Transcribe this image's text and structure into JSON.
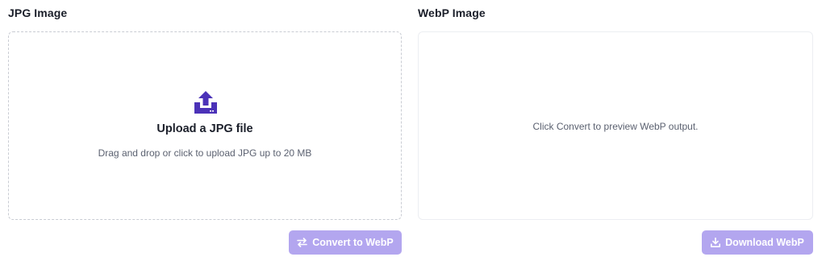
{
  "input_panel": {
    "title": "JPG Image",
    "dropzone": {
      "icon": "upload-icon",
      "title": "Upload a JPG file",
      "hint": "Drag and drop or click to upload JPG up to 20 MB"
    },
    "convert_button": {
      "icon": "swap-arrows-icon",
      "label": "Convert to WebP"
    }
  },
  "output_panel": {
    "title": "WebP Image",
    "preview_placeholder": "Click Convert to preview WebP output.",
    "download_button": {
      "icon": "download-icon",
      "label": "Download WebP"
    }
  },
  "colors": {
    "accent": "#4b32b8",
    "button_disabled": "#b3a6ef",
    "text_primary": "#1b1f2a",
    "text_muted": "#5b6170",
    "border": "#c9ccd3"
  }
}
